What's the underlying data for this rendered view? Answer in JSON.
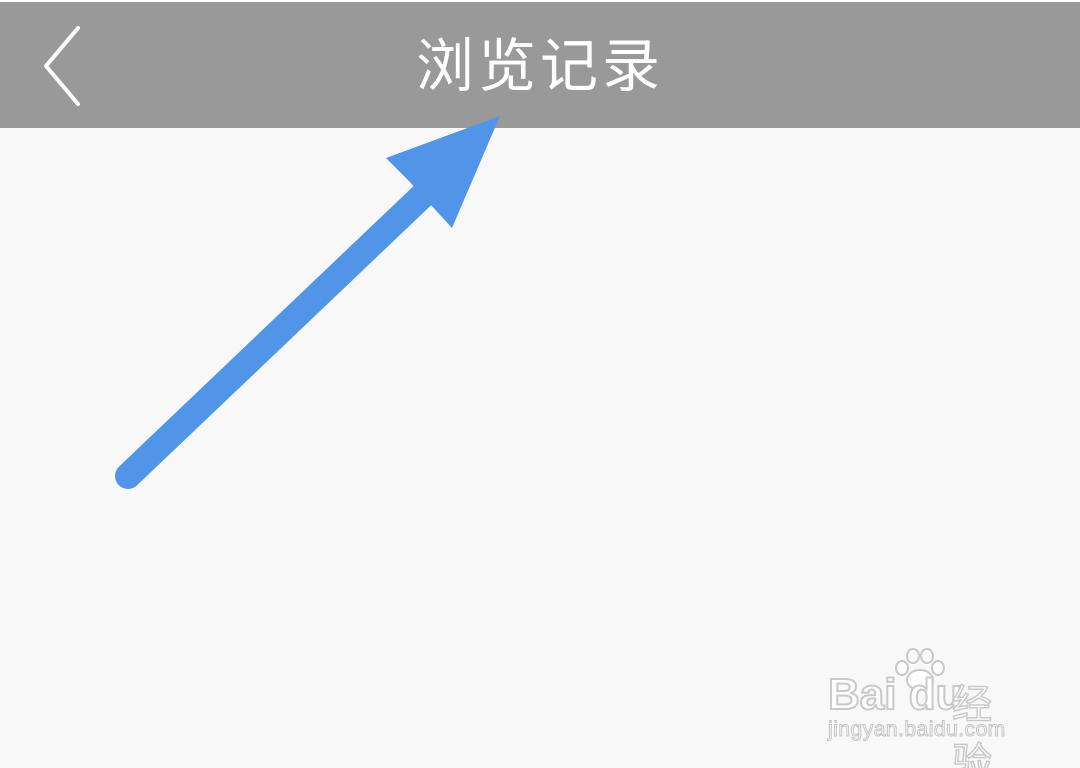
{
  "header": {
    "title": "浏览记录",
    "back_icon": "chevron-left-icon",
    "background_color": "#999999",
    "text_color": "#ffffff"
  },
  "annotation": {
    "arrow_color": "#5195e9",
    "icon": "arrow-up-right-icon"
  },
  "watermark": {
    "brand": "Bai du",
    "product": "经验",
    "url": "jingyan.baidu.com",
    "icon": "paw-icon"
  }
}
